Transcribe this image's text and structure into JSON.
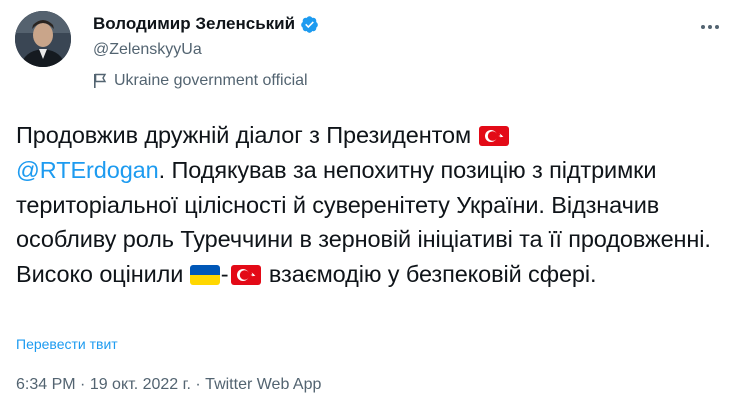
{
  "author": {
    "display_name": "Володимир Зеленський",
    "handle": "@ZelenskyyUa",
    "affiliation": "Ukraine government official",
    "verified_icon": "verified-badge-icon",
    "colors": {
      "verified": "#1d9bf0",
      "secondary_text": "#536471"
    }
  },
  "tweet": {
    "line1": "Продовжив дружній діалог з Президентом ",
    "mention": "@RTErdogan",
    "line2": ". Подякував за непохитну позицію з підтримки територіальної цілісності й суверенітету України. Відзначив особливу роль Туреччини в зерновій ініціативі та її продовженні. Високо оцінили ",
    "dash": "-",
    "line3": " взаємодію у безпековій сфері.",
    "emoji": {
      "turkey": "turkey-flag-icon",
      "ukraine": "ukraine-flag-icon"
    },
    "colors": {
      "mention": "#1d9bf0",
      "turkey_red": "#e30a17",
      "ukraine_blue": "#0057b7",
      "ukraine_yellow": "#ffd700"
    }
  },
  "translate_label": "Перевести твит",
  "meta": {
    "time": "6:34 PM",
    "sep1": " · ",
    "date": "19 окт. 2022 г.",
    "sep2": " · ",
    "source": "Twitter Web App"
  }
}
